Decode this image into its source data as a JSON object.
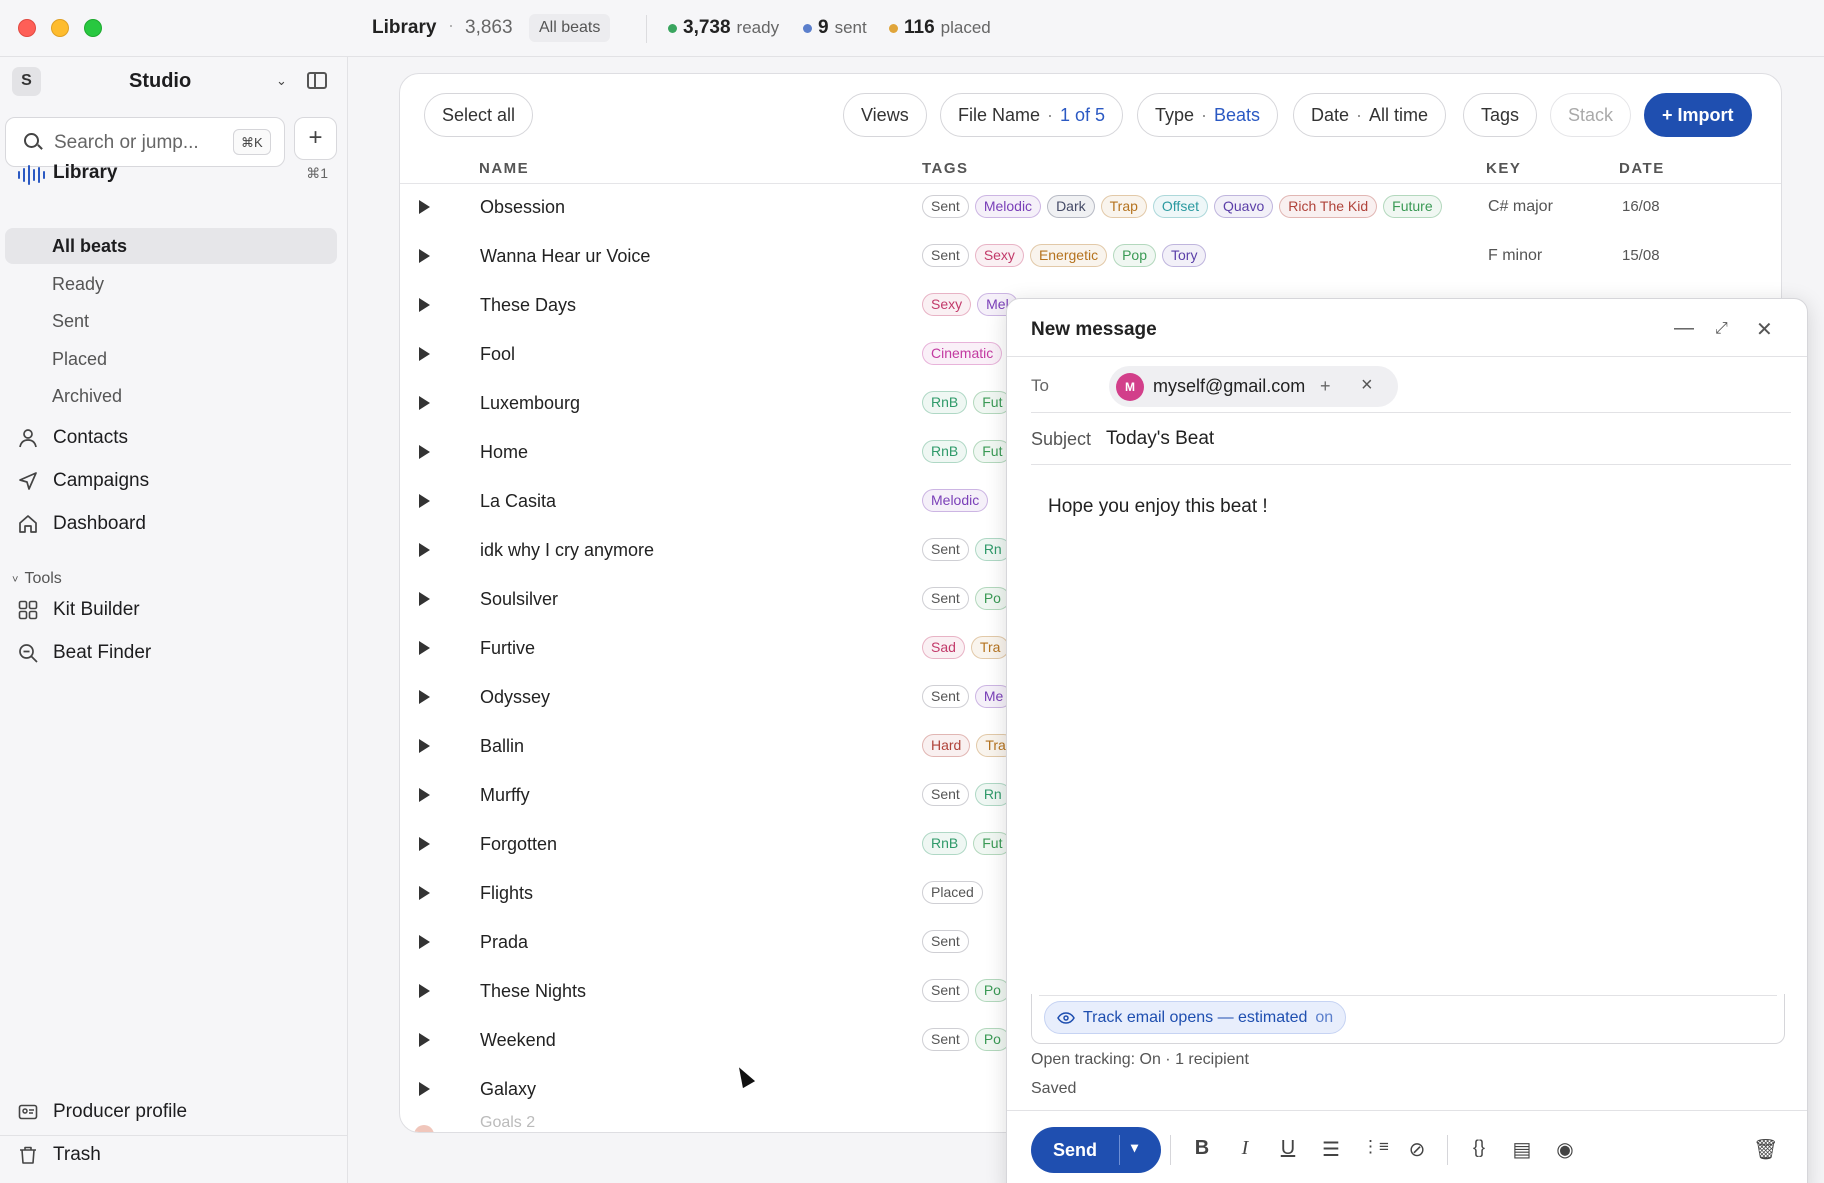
{
  "titlebar": {
    "title": "Library",
    "count": "3,863",
    "filter_badge": "All beats",
    "stats": [
      {
        "value": "3,738",
        "label": "ready",
        "color": "#3aa55f"
      },
      {
        "value": "9",
        "label": "sent",
        "color": "#5b7fcc"
      },
      {
        "value": "116",
        "label": "placed",
        "color": "#e0a53a"
      }
    ]
  },
  "sidebar": {
    "workspace_initial": "S",
    "workspace_name": "Studio",
    "search_placeholder": "Search or jump...",
    "search_shortcut": "⌘K",
    "library": {
      "label": "Library",
      "shortcut": "⌘1"
    },
    "library_sub": [
      "All beats",
      "Ready",
      "Sent",
      "Placed",
      "Archived"
    ],
    "nav": [
      "Contacts",
      "Campaigns",
      "Dashboard"
    ],
    "tools_header": "Tools",
    "tools": [
      "Kit Builder",
      "Beat Finder"
    ],
    "bottom": [
      "Producer profile",
      "Trash"
    ]
  },
  "toolbar": {
    "select_all": "Select all",
    "views": "Views",
    "file_name_label": "File Name",
    "file_name_value": "1 of 5",
    "type_label": "Type",
    "type_value": "Beats",
    "date_label": "Date",
    "date_value": "All time",
    "tags": "Tags",
    "stack": "Stack",
    "import": "+ Import"
  },
  "table": {
    "headers": {
      "name": "NAME",
      "tags": "TAGS",
      "key": "KEY",
      "date": "DATE"
    },
    "rows": [
      {
        "name": "Obsession",
        "tags": [
          "Sent",
          "Melodic",
          "Dark",
          "Trap",
          "Offset",
          "Quavo",
          "Rich The Kid",
          "Future"
        ],
        "key": "C# major",
        "date": "16/08"
      },
      {
        "name": "Wanna Hear ur Voice",
        "tags": [
          "Sent",
          "Sexy",
          "Energetic",
          "Pop",
          "Tory"
        ],
        "key": "F minor",
        "date": "15/08"
      },
      {
        "name": "These Days",
        "tags": [
          "Sexy",
          "Mel"
        ],
        "key": "",
        "date": ""
      },
      {
        "name": "Fool",
        "tags": [
          "Cinematic"
        ],
        "key": "",
        "date": ""
      },
      {
        "name": "Luxembourg",
        "tags": [
          "RnB",
          "Fut"
        ],
        "key": "",
        "date": ""
      },
      {
        "name": "Home",
        "tags": [
          "RnB",
          "Fut"
        ],
        "key": "",
        "date": ""
      },
      {
        "name": "La Casita",
        "tags": [
          "Melodic"
        ],
        "key": "",
        "date": ""
      },
      {
        "name": "idk why I cry anymore",
        "tags": [
          "Sent",
          "Rn"
        ],
        "key": "",
        "date": ""
      },
      {
        "name": "Soulsilver",
        "tags": [
          "Sent",
          "Po"
        ],
        "key": "",
        "date": ""
      },
      {
        "name": "Furtive",
        "tags": [
          "Sad",
          "Tra"
        ],
        "key": "",
        "date": ""
      },
      {
        "name": "Odyssey",
        "tags": [
          "Sent",
          "Me"
        ],
        "key": "",
        "date": ""
      },
      {
        "name": "Ballin",
        "tags": [
          "Hard",
          "Tra"
        ],
        "key": "",
        "date": ""
      },
      {
        "name": "Murffy",
        "tags": [
          "Sent",
          "Rn"
        ],
        "key": "",
        "date": ""
      },
      {
        "name": "Forgotten",
        "tags": [
          "RnB",
          "Fut"
        ],
        "key": "",
        "date": ""
      },
      {
        "name": "Flights",
        "tags": [
          "Placed"
        ],
        "key": "",
        "date": ""
      },
      {
        "name": "Prada",
        "tags": [
          "Sent"
        ],
        "key": "",
        "date": ""
      },
      {
        "name": "These Nights",
        "tags": [
          "Sent",
          "Po"
        ],
        "key": "",
        "date": ""
      },
      {
        "name": "Weekend",
        "tags": [
          "Sent",
          "Po"
        ],
        "key": "",
        "date": ""
      },
      {
        "name": "Galaxy",
        "tags": [],
        "key": "",
        "date": ""
      }
    ],
    "partial_row": "Goals 2"
  },
  "tag_colors": {
    "Sent": "#555555",
    "Melodic": "#7a3fb8",
    "Mel": "#7a3fb8",
    "Me": "#7a3fb8",
    "Dark": "#444a66",
    "Trap": "#b5731f",
    "Tra": "#b5731f",
    "Offset": "#2b9aa0",
    "Quavo": "#5b3fa8",
    "Rich The Kid": "#b0433a",
    "Future": "#3a9a55",
    "Fut": "#3a9a55",
    "Sexy": "#c23a6a",
    "Energetic": "#b5731f",
    "Pop": "#3a9a55",
    "Po": "#3a9a55",
    "Tory": "#5b3fa8",
    "Cinematic": "#c23aa0",
    "RnB": "#2f9a6a",
    "Rn": "#2f9a6a",
    "Sad": "#c23a6a",
    "Hard": "#b0433a",
    "Placed": "#555555"
  },
  "message": {
    "title": "New message",
    "to_label": "To",
    "recipient_initial": "M",
    "recipient": "myself@gmail.com",
    "subject_label": "Subject",
    "subject": "Today's Beat",
    "body": "Hope you enjoy this beat !",
    "track_label": "Track email opens — estimated",
    "track_state": "on",
    "open_tracking": "Open tracking: On · 1 recipient",
    "saved": "Saved",
    "send": "Send"
  }
}
